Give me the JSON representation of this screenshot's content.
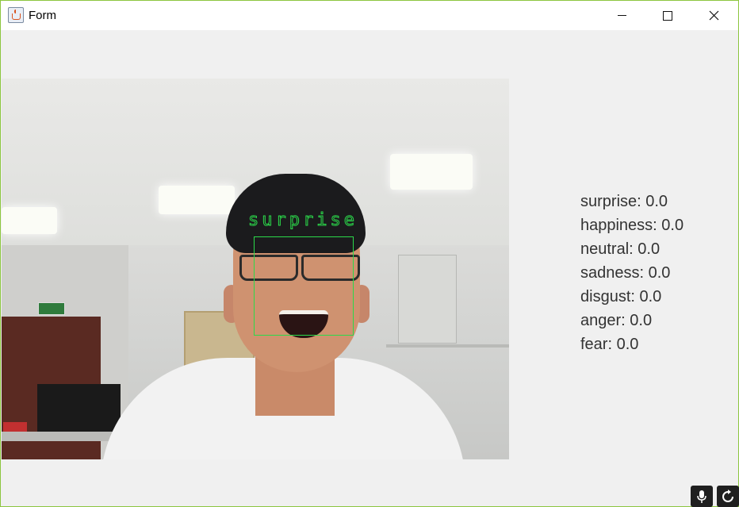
{
  "window": {
    "title": "Form",
    "icon": "java-coffee-cup-icon",
    "controls": [
      "minimize-icon",
      "maximize-icon",
      "close-icon"
    ],
    "border_color": "#8cc63f"
  },
  "camera": {
    "overlay_label": "surprise",
    "overlay_color": "#2bd94a"
  },
  "emotions": [
    {
      "name": "surprise",
      "value": "0.0",
      "text": "surprise: 0.0"
    },
    {
      "name": "happiness",
      "value": "0.0",
      "text": "happiness: 0.0"
    },
    {
      "name": "neutral",
      "value": "0.0",
      "text": "neutral: 0.0"
    },
    {
      "name": "sadness",
      "value": "0.0",
      "text": "sadness: 0.0"
    },
    {
      "name": "disgust",
      "value": "0.0",
      "text": "disgust: 0.0"
    },
    {
      "name": "anger",
      "value": "0.0",
      "text": "anger: 0.0"
    },
    {
      "name": "fear",
      "value": "0.0",
      "text": "fear: 0.0"
    }
  ],
  "tray": {
    "mic_icon": "microphone-icon",
    "cam_icon": "refresh-icon"
  }
}
